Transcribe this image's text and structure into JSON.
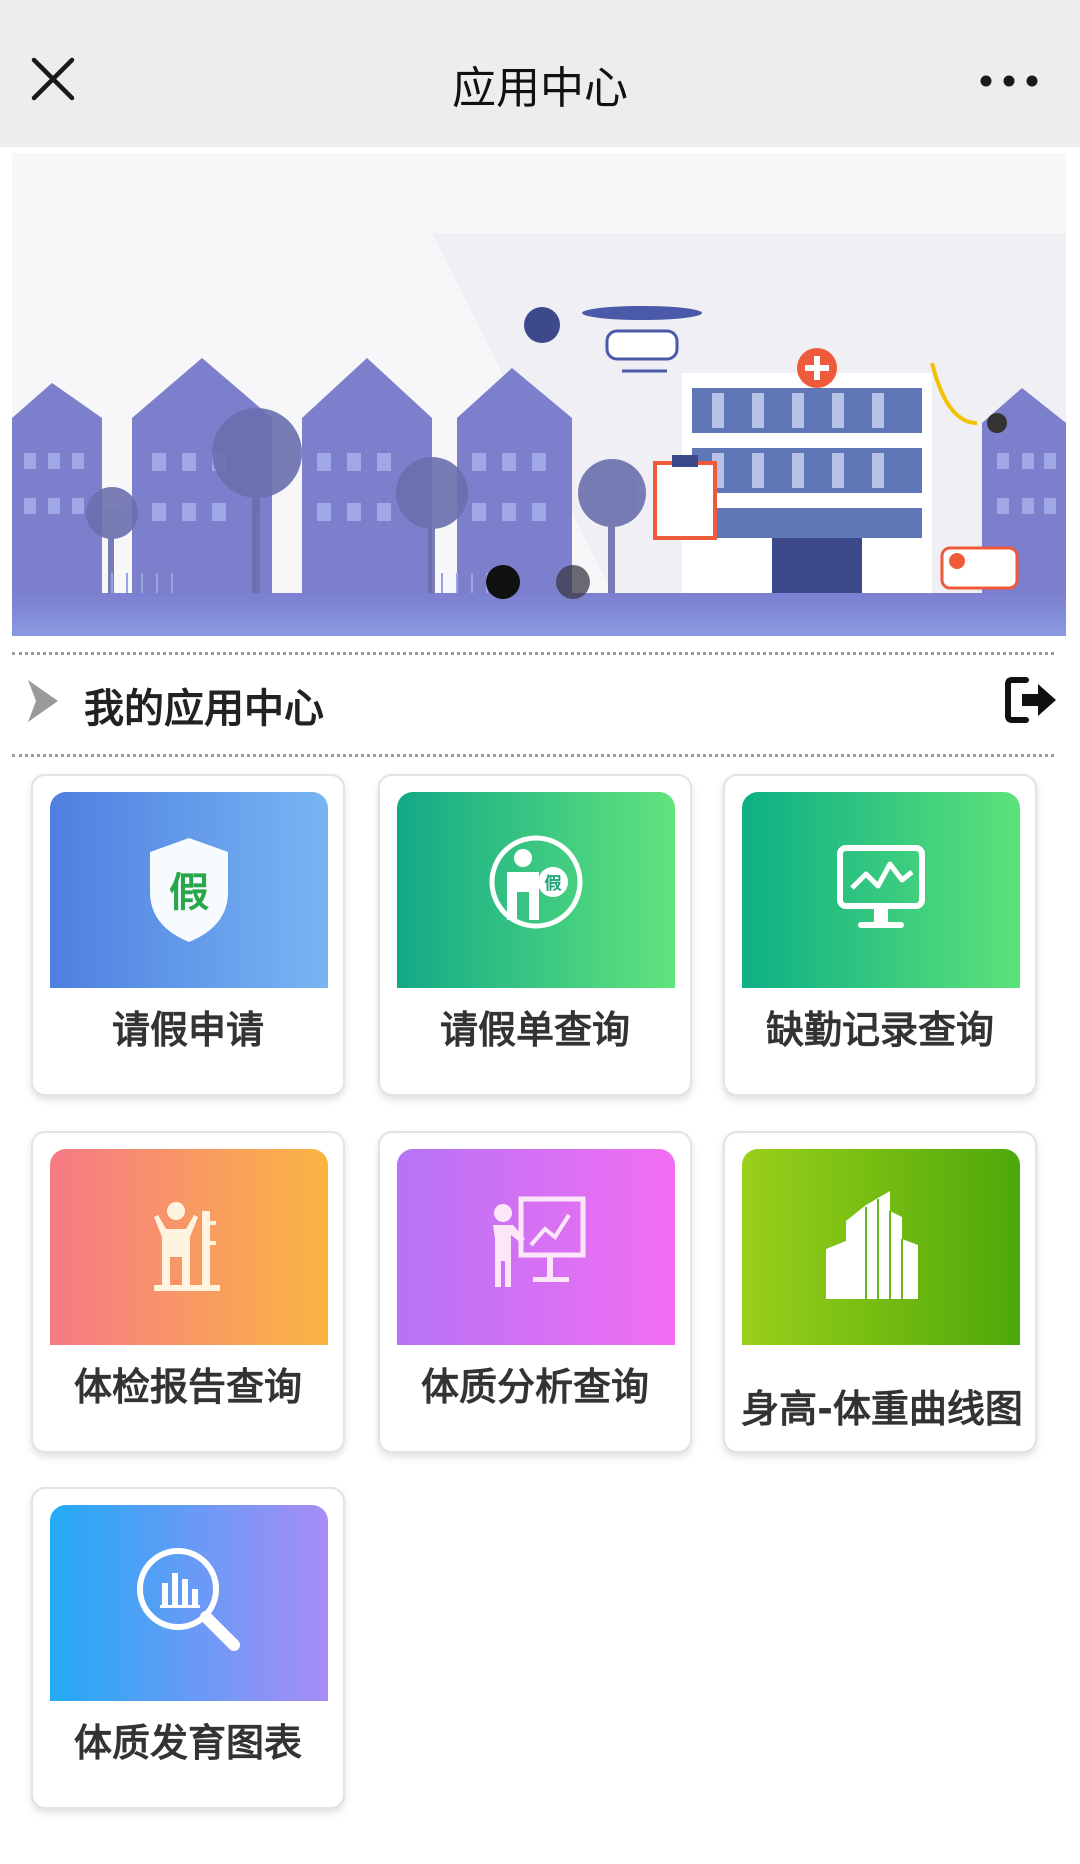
{
  "header": {
    "title": "应用中心"
  },
  "section": {
    "title": "我的应用中心"
  },
  "apps": [
    {
      "label": "请假申请",
      "icon": "leave-shield-icon"
    },
    {
      "label": "请假单查询",
      "icon": "person-leave-icon"
    },
    {
      "label": "缺勤记录查询",
      "icon": "monitor-chart-icon"
    },
    {
      "label": "体检报告查询",
      "icon": "height-measure-icon"
    },
    {
      "label": "体质分析查询",
      "icon": "presentation-icon"
    },
    {
      "label": "身高-体重曲线图",
      "icon": "buildings-icon"
    },
    {
      "label": "体质发育图表",
      "icon": "magnifier-chart-icon"
    }
  ],
  "icon_text": {
    "leave_char": "假",
    "leave_char_small": "假"
  },
  "colors": {
    "header_bg": "#ededed",
    "tile_1": "#4f7fe0",
    "tile_2": "#13a987",
    "tile_3": "#0daf84",
    "tile_4": "#f67a86",
    "tile_5": "#b673f5",
    "tile_6": "#9ad01a",
    "tile_7": "#22aaf6"
  }
}
